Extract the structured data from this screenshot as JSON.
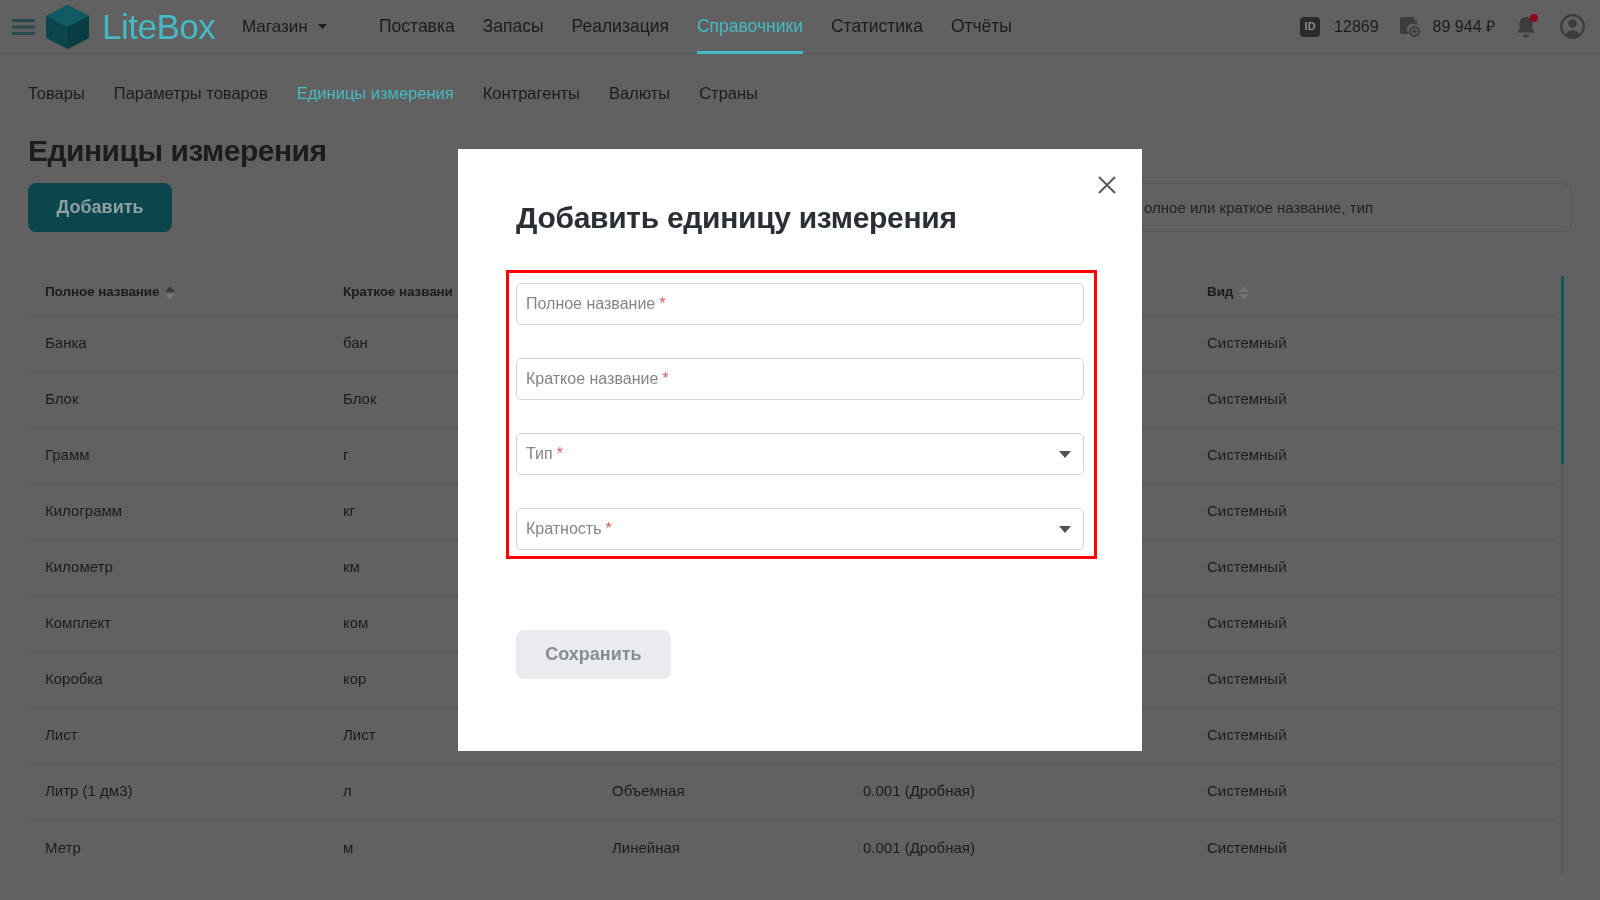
{
  "header": {
    "logo_text": "LiteBox",
    "store": "Магазин",
    "nav": [
      {
        "label": "Поставка",
        "selected": false
      },
      {
        "label": "Запасы",
        "selected": false
      },
      {
        "label": "Реализация",
        "selected": false
      },
      {
        "label": "Справочники",
        "selected": true
      },
      {
        "label": "Статистика",
        "selected": false
      },
      {
        "label": "Отчёты",
        "selected": false
      }
    ],
    "account_badge": "ID",
    "account_id": "12869",
    "balance": "89 944 ₽",
    "notifications": {
      "unread": true
    }
  },
  "subnav": [
    {
      "label": "Товары",
      "selected": false
    },
    {
      "label": "Параметры товаров",
      "selected": false
    },
    {
      "label": "Единицы измерения",
      "selected": true
    },
    {
      "label": "Контрагенты",
      "selected": false
    },
    {
      "label": "Валюты",
      "selected": false
    },
    {
      "label": "Страны",
      "selected": false
    }
  ],
  "page_title": "Единицы измерения",
  "add_button": "Добавить",
  "search": {
    "placeholder": "олное или краткое название, тип"
  },
  "table": {
    "columns": [
      {
        "label": "Полное название",
        "sorted": true
      },
      {
        "label": "Краткое названи"
      },
      null,
      null,
      {
        "label": "Вид",
        "sorted": false
      }
    ],
    "rows": [
      {
        "cells": [
          "Банка",
          "бан",
          null,
          null,
          "Системный"
        ]
      },
      {
        "cells": [
          "Блок",
          "Блок",
          null,
          null,
          "Системный"
        ]
      },
      {
        "cells": [
          "Грамм",
          "г",
          null,
          null,
          "Системный"
        ]
      },
      {
        "cells": [
          "Килограмм",
          "кг",
          null,
          null,
          "Системный"
        ]
      },
      {
        "cells": [
          "Километр",
          "км",
          null,
          null,
          "Системный"
        ]
      },
      {
        "cells": [
          "Комплект",
          "ком",
          null,
          null,
          "Системный"
        ]
      },
      {
        "cells": [
          "Коробка",
          "кор",
          null,
          null,
          "Системный"
        ]
      },
      {
        "cells": [
          "Лист",
          "Лист",
          null,
          null,
          "Системный"
        ]
      },
      {
        "cells": [
          "Литр (1 дм3)",
          "л",
          "Объемная",
          "0.001 (Дробная)",
          "Системный"
        ]
      },
      {
        "cells": [
          "Метр",
          "м",
          "Линейная",
          "0.001 (Дробная)",
          "Системный"
        ]
      }
    ]
  },
  "dialog": {
    "title": "Добавить единицу измерения",
    "highlighted": true,
    "fields": [
      {
        "kind": "text",
        "placeholder": "Полное название",
        "required_mark": "*"
      },
      {
        "kind": "text",
        "placeholder": "Краткое название",
        "required_mark": "*"
      },
      {
        "kind": "select",
        "placeholder": "Тип",
        "required_mark": "*"
      },
      {
        "kind": "select",
        "placeholder": "Кратность",
        "required_mark": "*"
      }
    ],
    "save_button": {
      "label": "Сохранить",
      "disabled": true
    }
  }
}
